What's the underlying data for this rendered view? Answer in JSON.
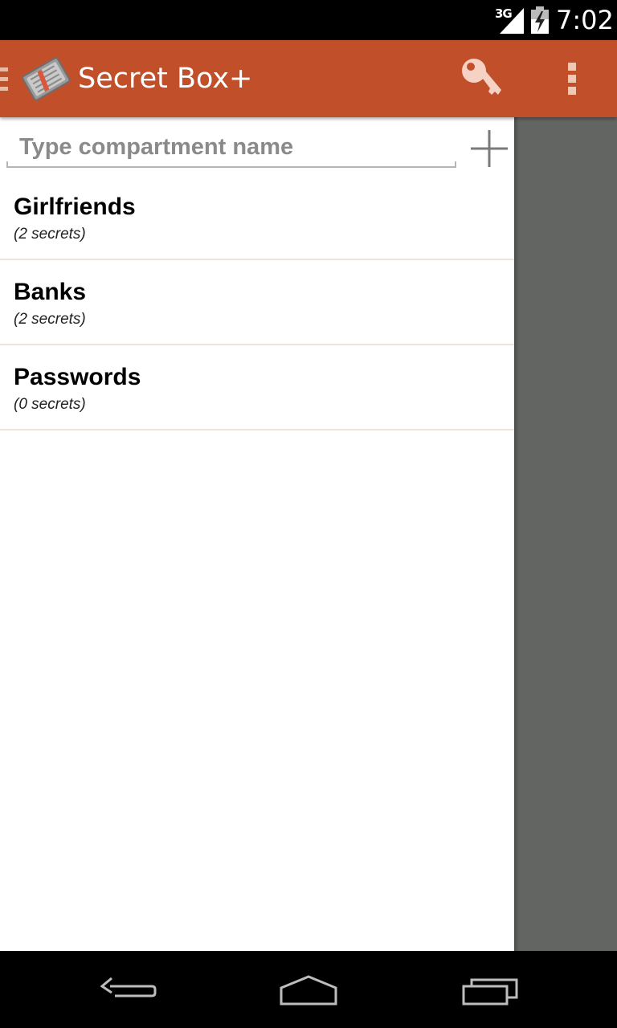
{
  "status_bar": {
    "network": "3G",
    "time": "7:02"
  },
  "action_bar": {
    "title": "Secret Box+",
    "background_color": "#c14f2a",
    "icons": [
      "app-logo-icon",
      "key-icon",
      "overflow-menu-icon"
    ]
  },
  "drawer": {
    "input": {
      "placeholder": "Type compartment name",
      "value": ""
    },
    "add_icon": "plus-icon",
    "compartments": [
      {
        "name": "Girlfriends",
        "count": "(2 secrets)"
      },
      {
        "name": "Banks",
        "count": "(2 secrets)"
      },
      {
        "name": "Passwords",
        "count": "(0 secrets)"
      }
    ]
  },
  "nav_bar": {
    "icons": [
      "back-icon",
      "home-icon",
      "recents-icon"
    ]
  }
}
